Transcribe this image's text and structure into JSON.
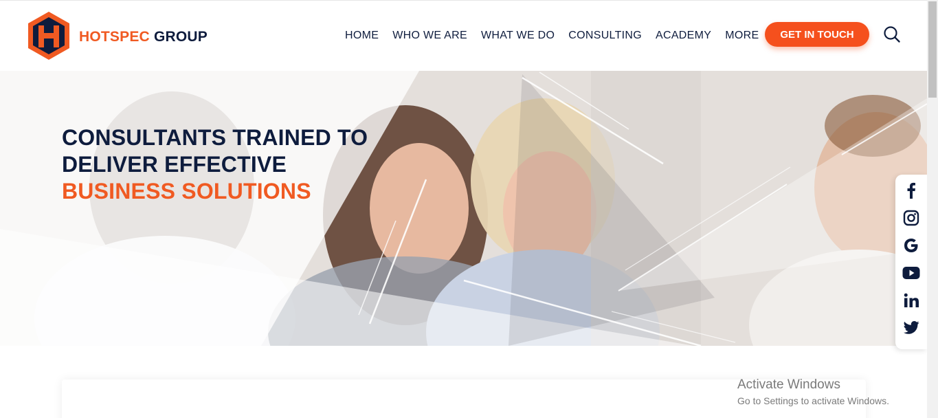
{
  "header": {
    "brand_primary": "HOTSPEC",
    "brand_secondary": "GROUP",
    "nav": [
      "HOME",
      "WHO WE ARE",
      "WHAT WE DO",
      "CONSULTING",
      "ACADEMY",
      "MORE"
    ],
    "cta_label": "GET IN TOUCH",
    "search_icon": "search-icon"
  },
  "hero": {
    "line1": "CONSULTANTS TRAINED TO",
    "line2": "DELIVER EFFECTIVE",
    "line3": "BUSINESS SOLUTIONS"
  },
  "social": [
    "facebook-icon",
    "instagram-icon",
    "google-icon",
    "youtube-icon",
    "linkedin-icon",
    "twitter-icon"
  ],
  "watermark": {
    "title": "Activate Windows",
    "subtitle": "Go to Settings to activate Windows."
  },
  "colors": {
    "accent": "#f05a22",
    "navy": "#0e1c3d"
  }
}
